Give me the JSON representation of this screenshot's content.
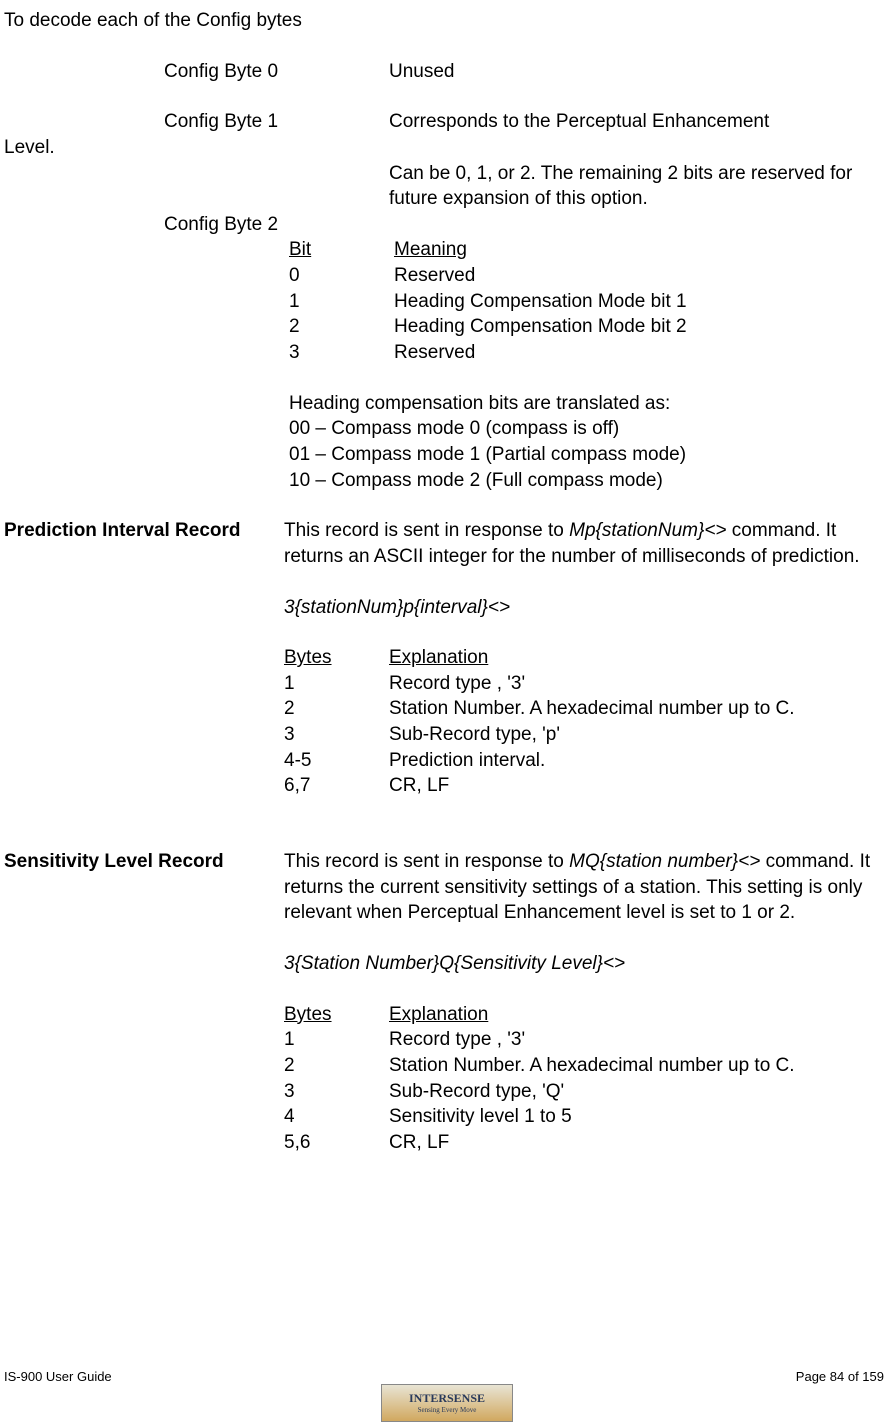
{
  "intro": "To decode each of the Config bytes",
  "cb0": {
    "label": "Config Byte 0",
    "desc": "Unused"
  },
  "cb1": {
    "label": "Config Byte 1",
    "desc1": "Corresponds to the Perceptual Enhancement",
    "desc1b": "Level.",
    "desc2": "Can be 0, 1, or 2. The remaining 2 bits are reserved for future expansion of this option."
  },
  "cb2": {
    "label": "Config Byte 2",
    "hbit": "Bit",
    "hmeaning": "Meaning",
    "rows": [
      {
        "bit": "0",
        "m": "Reserved"
      },
      {
        "bit": "1",
        "m": "Heading Compensation Mode bit 1"
      },
      {
        "bit": "2",
        "m": "Heading Compensation Mode bit 2"
      },
      {
        "bit": "3",
        "m": "Reserved"
      }
    ],
    "note": "Heading compensation bits are translated as:",
    "modes": [
      "00 – Compass mode 0 (compass is off)",
      "01 – Compass mode 1 (Partial compass mode)",
      "10 – Compass mode 2 (Full compass mode)"
    ]
  },
  "pir": {
    "title": "Prediction Interval Record",
    "p1a": "This record is sent in response to ",
    "p1cmd": "Mp{stationNum}<>",
    "p1b": " command. It returns an ASCII integer for the number of milliseconds of prediction.",
    "fmt": "3{stationNum}p{interval}<>",
    "hb": "Bytes",
    "he": "Explanation",
    "rows": [
      {
        "b": "1",
        "e": "Record type , '3'"
      },
      {
        "b": "2",
        "e": "Station Number. A hexadecimal number up to C."
      },
      {
        "b": "3",
        "e": "Sub-Record type, 'p'"
      },
      {
        "b": "4-5",
        "e": "Prediction interval."
      },
      {
        "b": "6,7",
        "e": "CR, LF"
      }
    ]
  },
  "slr": {
    "title": "Sensitivity Level Record",
    "p1a": "This record is sent in response to ",
    "p1cmd": "MQ{station number}<>",
    "p1b": " command. It returns the current sensitivity settings of a station. This setting is only relevant when Perceptual Enhancement level is set to 1 or 2.",
    "fmt": "3{Station Number}Q{Sensitivity Level}<>",
    "hb": "Bytes",
    "he": "Explanation",
    "rows": [
      {
        "b": "1",
        "e": "Record type , '3'"
      },
      {
        "b": "2",
        "e": "Station Number. A hexadecimal number up to C."
      },
      {
        "b": "3",
        "e": "Sub-Record type, 'Q'"
      },
      {
        "b": "4",
        "e": "Sensitivity level 1 to 5"
      },
      {
        "b": "5,6",
        "e": "CR, LF"
      }
    ]
  },
  "footer": {
    "left": "IS-900 User Guide",
    "right": "Page 84 of 159",
    "logo": "INTERSENSE",
    "tag": "Sensing Every Move"
  }
}
